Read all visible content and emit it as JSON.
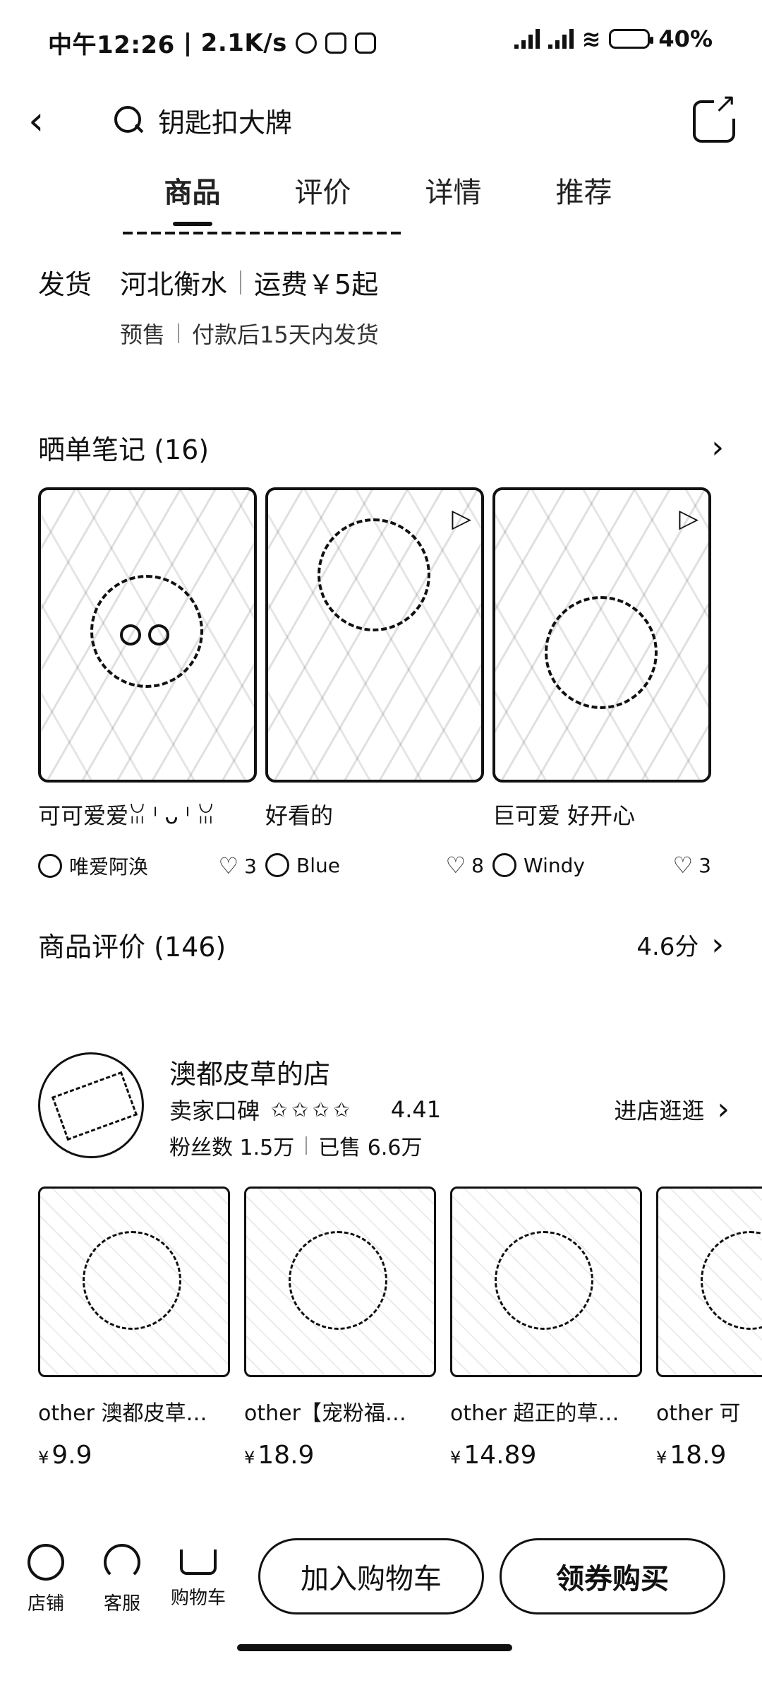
{
  "status_bar": {
    "time": "中午12:26",
    "net_speed": "2.1K/s",
    "battery": "40%"
  },
  "header": {
    "search_text": "钥匙扣大牌"
  },
  "tabs": [
    {
      "label": "商品",
      "active": true
    },
    {
      "label": "评价",
      "active": false
    },
    {
      "label": "详情",
      "active": false
    },
    {
      "label": "推荐",
      "active": false
    }
  ],
  "shipping": {
    "label": "发货",
    "origin": "河北衡水",
    "fee": "运费￥5起",
    "presale": "预售",
    "ship_time": "付款后15天内发货"
  },
  "notes": {
    "title": "晒单笔记 (16)",
    "items": [
      {
        "caption": "可可爱爱ꈍ ᴵ ᴗ ᴵ ꈍ",
        "user": "唯爱阿涣",
        "likes": "3"
      },
      {
        "caption": "好看的",
        "user": "Blue",
        "likes": "8"
      },
      {
        "caption": "巨可爱 好开心",
        "user": "Windy",
        "likes": "3"
      }
    ]
  },
  "reviews": {
    "title": "商品评价 (146)",
    "score": "4.6分"
  },
  "store": {
    "name": "澳都皮草的店",
    "rep_label": "卖家口碑",
    "stars": "✩✩✩✩",
    "rating": "4.41",
    "fans": "粉丝数 1.5万",
    "sold": "已售 6.6万",
    "enter": "进店逛逛"
  },
  "products": [
    {
      "name": "other 澳都皮草…",
      "price": "9.9"
    },
    {
      "name": "other【宠粉福…",
      "price": "18.9"
    },
    {
      "name": "other 超正的草…",
      "price": "14.89"
    },
    {
      "name": "other 可",
      "price": "18.9"
    }
  ],
  "bottom_bar": {
    "shop": "店铺",
    "service": "客服",
    "cart": "购物车",
    "add_cart": "加入购物车",
    "buy": "领券购买"
  },
  "icons": [
    "back-icon",
    "search-icon",
    "share-icon",
    "chevron-right-icon",
    "heart-icon",
    "store-icon",
    "headset-icon",
    "cart-icon"
  ]
}
